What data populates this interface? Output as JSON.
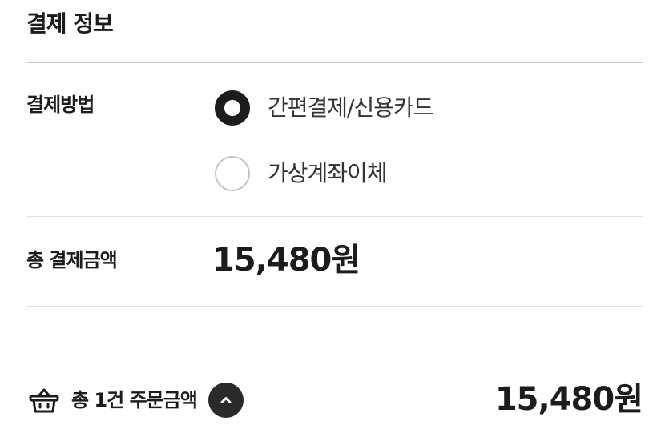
{
  "payment": {
    "title": "결제 정보",
    "method_label": "결제방법",
    "methods": [
      {
        "label": "간편결제/신용카드",
        "selected": true
      },
      {
        "label": "가상계좌이체",
        "selected": false
      }
    ],
    "total_label": "총 결제금액",
    "total_amount": "15,480원"
  },
  "footer": {
    "summary_prefix": "총 1건 주문금액",
    "amount": "15,480원",
    "basket_icon": "basket-icon",
    "toggle_icon": "chevron-up-icon"
  },
  "colors": {
    "text": "#1c1c1c",
    "radio_selected": "#1c1c1c",
    "radio_unselected_border": "#c4c4c4",
    "divider": "#e2e2e2",
    "toggle_background": "#2a2a2a"
  }
}
